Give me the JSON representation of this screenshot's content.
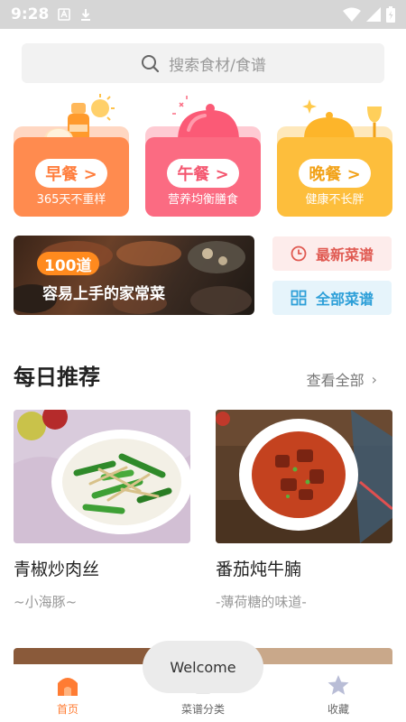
{
  "status_bar": {
    "time": "9:28"
  },
  "search": {
    "placeholder": "搜索食材/食谱"
  },
  "meals": [
    {
      "label": "早餐 >",
      "subtitle": "365天不重样",
      "color": "#ff8b4f",
      "text_color": "#ff7d3c"
    },
    {
      "label": "午餐 >",
      "subtitle": "营养均衡膳食",
      "color": "#fb6b82",
      "text_color": "#f4566f"
    },
    {
      "label": "晚餐 >",
      "subtitle": "健康不长胖",
      "color": "#fdbe3c",
      "text_color": "#f2a218"
    }
  ],
  "banner": {
    "tag": "100道",
    "caption": "容易上手的家常菜"
  },
  "quick_links": {
    "latest": "最新菜谱",
    "all": "全部菜谱"
  },
  "daily": {
    "title": "每日推荐",
    "see_all": "查看全部",
    "recipes": [
      {
        "title": "青椒炒肉丝",
        "author": "~小海豚~"
      },
      {
        "title": "番茄炖牛腩",
        "author": "-薄荷糖的味道-"
      }
    ]
  },
  "toast": {
    "text": "Welcome"
  },
  "tabbar": {
    "items": [
      {
        "label": "首页",
        "icon": "home-icon",
        "active": true
      },
      {
        "label": "菜谱分类",
        "icon": "category-icon",
        "active": false
      },
      {
        "label": "收藏",
        "icon": "star-icon",
        "active": false
      }
    ]
  },
  "colors": {
    "accent": "#ff7c33",
    "red_link": "#e05a52",
    "blue_link": "#2d9fd8"
  }
}
